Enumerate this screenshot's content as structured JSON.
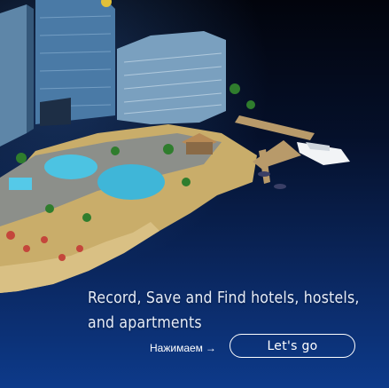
{
  "card": {
    "tagline": "Record, Save and Find hotels, hostels, and apartments",
    "hint": "Нажимаем",
    "cta_label": "Let's go",
    "colors": {
      "accent_border": "#ffffff",
      "background_top": "#02040c",
      "background_bottom": "#0d3a8a"
    }
  },
  "icons": {
    "hint_arrow": "arrow-right-icon"
  }
}
